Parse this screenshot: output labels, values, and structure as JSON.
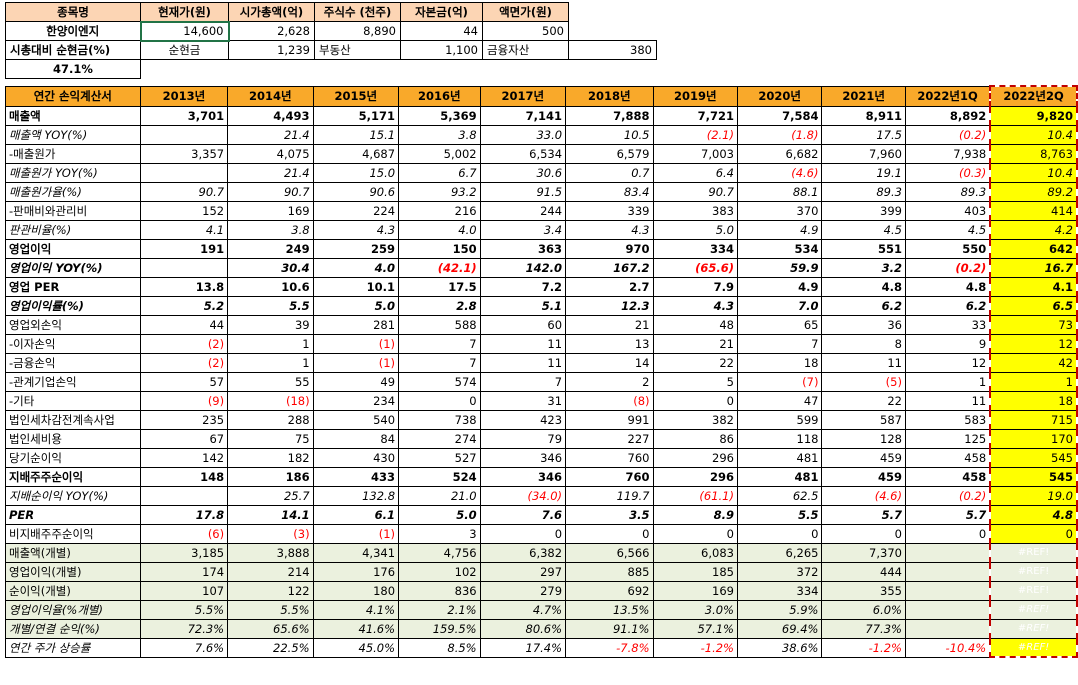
{
  "info": {
    "headers": [
      "종목명",
      "현재가(원)",
      "시가총액(억)",
      "주식수 (천주)",
      "자본금(억)",
      "액면가(원)"
    ],
    "row1": [
      "한양이엔지",
      "14,600",
      "2,628",
      "8,890",
      "44",
      "500"
    ],
    "cash_ratio_label": "시총대비 순현금(%)",
    "cash_ratio_value": "47.1%",
    "row2": [
      "순현금",
      "1,239",
      "부동산",
      "1,100",
      "금융자산",
      "380"
    ]
  },
  "table": {
    "corner": "연간 손익계산서",
    "years": [
      "2013년",
      "2014년",
      "2015년",
      "2016년",
      "2017년",
      "2018년",
      "2019년",
      "2020년",
      "2021년",
      "2022년1Q",
      "2022년2Q"
    ],
    "rows": [
      {
        "label": "매출액",
        "style": "b",
        "values": [
          "3,701",
          "4,493",
          "5,171",
          "5,369",
          "7,141",
          "7,888",
          "7,721",
          "7,584",
          "8,911",
          "8,892",
          "9,820"
        ]
      },
      {
        "label": "매출액 YOY(%)",
        "style": "i",
        "values": [
          "",
          "21.4",
          "15.1",
          "3.8",
          "33.0",
          "10.5",
          "(2.1)",
          "(1.8)",
          "17.5",
          "(0.2)",
          "10.4"
        ]
      },
      {
        "label": "-매출원가",
        "style": "",
        "values": [
          "3,357",
          "4,075",
          "4,687",
          "5,002",
          "6,534",
          "6,579",
          "7,003",
          "6,682",
          "7,960",
          "7,938",
          "8,763"
        ]
      },
      {
        "label": "매출원가 YOY(%)",
        "style": "i",
        "values": [
          "",
          "21.4",
          "15.0",
          "6.7",
          "30.6",
          "0.7",
          "6.4",
          "(4.6)",
          "19.1",
          "(0.3)",
          "10.4"
        ]
      },
      {
        "label": "매출원가율(%)",
        "style": "i",
        "values": [
          "90.7",
          "90.7",
          "90.6",
          "93.2",
          "91.5",
          "83.4",
          "90.7",
          "88.1",
          "89.3",
          "89.3",
          "89.2"
        ]
      },
      {
        "label": "-판매비와관리비",
        "style": "",
        "values": [
          "152",
          "169",
          "224",
          "216",
          "244",
          "339",
          "383",
          "370",
          "399",
          "403",
          "414"
        ]
      },
      {
        "label": "판관비율(%)",
        "style": "i",
        "values": [
          "4.1",
          "3.8",
          "4.3",
          "4.0",
          "3.4",
          "4.3",
          "5.0",
          "4.9",
          "4.5",
          "4.5",
          "4.2"
        ]
      },
      {
        "label": "영업이익",
        "style": "b",
        "values": [
          "191",
          "249",
          "259",
          "150",
          "363",
          "970",
          "334",
          "534",
          "551",
          "550",
          "642"
        ]
      },
      {
        "label": "영업이익 YOY(%)",
        "style": "bi",
        "values": [
          "",
          "30.4",
          "4.0",
          "(42.1)",
          "142.0",
          "167.2",
          "(65.6)",
          "59.9",
          "3.2",
          "(0.2)",
          "16.7"
        ]
      },
      {
        "label": "영업 PER",
        "style": "b",
        "values": [
          "13.8",
          "10.6",
          "10.1",
          "17.5",
          "7.2",
          "2.7",
          "7.9",
          "4.9",
          "4.8",
          "4.8",
          "4.1"
        ]
      },
      {
        "label": "영업이익률(%)",
        "style": "bi",
        "values": [
          "5.2",
          "5.5",
          "5.0",
          "2.8",
          "5.1",
          "12.3",
          "4.3",
          "7.0",
          "6.2",
          "6.2",
          "6.5"
        ]
      },
      {
        "label": "영업외손익",
        "style": "",
        "values": [
          "44",
          "39",
          "281",
          "588",
          "60",
          "21",
          "48",
          "65",
          "36",
          "33",
          "73"
        ]
      },
      {
        "label": "-이자손익",
        "style": "",
        "values": [
          "(2)",
          "1",
          "(1)",
          "7",
          "11",
          "13",
          "21",
          "7",
          "8",
          "9",
          "12"
        ]
      },
      {
        "label": "-금융손익",
        "style": "",
        "values": [
          "(2)",
          "1",
          "(1)",
          "7",
          "11",
          "14",
          "22",
          "18",
          "11",
          "12",
          "42"
        ]
      },
      {
        "label": "-관계기업손익",
        "style": "",
        "values": [
          "57",
          "55",
          "49",
          "574",
          "7",
          "2",
          "5",
          "(7)",
          "(5)",
          "1",
          "1"
        ]
      },
      {
        "label": "-기타",
        "style": "",
        "values": [
          "(9)",
          "(18)",
          "234",
          "0",
          "31",
          "(8)",
          "0",
          "47",
          "22",
          "11",
          "18"
        ]
      },
      {
        "label": "법인세차감전계속사업",
        "style": "",
        "values": [
          "235",
          "288",
          "540",
          "738",
          "423",
          "991",
          "382",
          "599",
          "587",
          "583",
          "715"
        ]
      },
      {
        "label": "법인세비용",
        "style": "",
        "values": [
          "67",
          "75",
          "84",
          "274",
          "79",
          "227",
          "86",
          "118",
          "128",
          "125",
          "170"
        ]
      },
      {
        "label": "당기순이익",
        "style": "",
        "values": [
          "142",
          "182",
          "430",
          "527",
          "346",
          "760",
          "296",
          "481",
          "459",
          "458",
          "545"
        ]
      },
      {
        "label": "지배주주순이익",
        "style": "b",
        "values": [
          "148",
          "186",
          "433",
          "524",
          "346",
          "760",
          "296",
          "481",
          "459",
          "458",
          "545"
        ]
      },
      {
        "label": "지배순이익 YOY(%)",
        "style": "i",
        "values": [
          "",
          "25.7",
          "132.8",
          "21.0",
          "(34.0)",
          "119.7",
          "(61.1)",
          "62.5",
          "(4.6)",
          "(0.2)",
          "19.0"
        ]
      },
      {
        "label": "PER",
        "style": "bi",
        "values": [
          "17.8",
          "14.1",
          "6.1",
          "5.0",
          "7.6",
          "3.5",
          "8.9",
          "5.5",
          "5.7",
          "5.7",
          "4.8"
        ]
      },
      {
        "label": "비지배주주순이익",
        "style": "",
        "values": [
          "(6)",
          "(3)",
          "(1)",
          "3",
          "0",
          "0",
          "0",
          "0",
          "0",
          "0",
          "0"
        ]
      },
      {
        "label": "매출액(개별)",
        "style": "g",
        "values": [
          "3,185",
          "3,888",
          "4,341",
          "4,756",
          "6,382",
          "6,566",
          "6,083",
          "6,265",
          "7,370",
          "",
          "#REF!"
        ]
      },
      {
        "label": "영업이익(개별)",
        "style": "g",
        "values": [
          "174",
          "214",
          "176",
          "102",
          "297",
          "885",
          "185",
          "372",
          "444",
          "",
          "#REF!"
        ]
      },
      {
        "label": "순이익(개별)",
        "style": "g",
        "values": [
          "107",
          "122",
          "180",
          "836",
          "279",
          "692",
          "169",
          "334",
          "355",
          "",
          "#REF!"
        ]
      },
      {
        "label": "영업이익율(%개별)",
        "style": "gi",
        "values": [
          "5.5%",
          "5.5%",
          "4.1%",
          "2.1%",
          "4.7%",
          "13.5%",
          "3.0%",
          "5.9%",
          "6.0%",
          "",
          "#REF!"
        ]
      },
      {
        "label": "개별/연결 순익(%)",
        "style": "gi",
        "values": [
          "72.3%",
          "65.6%",
          "41.6%",
          "159.5%",
          "80.6%",
          "91.1%",
          "57.1%",
          "69.4%",
          "77.3%",
          "",
          "#REF!"
        ]
      },
      {
        "label": "연간 주가 상승률",
        "style": "i",
        "values": [
          "7.6%",
          "22.5%",
          "45.0%",
          "8.5%",
          "17.4%",
          "-7.8%",
          "-1.2%",
          "38.6%",
          "-1.2%",
          "-10.4%",
          "#REF!"
        ]
      }
    ]
  },
  "colors": {
    "header_orange": "#f9a92a",
    "info_header": "#fcd5b4",
    "highlight_yellow": "#ffff00",
    "green_rows": "#ebf1de",
    "negative": "#ff0000",
    "dashed_border": "#c00000"
  }
}
